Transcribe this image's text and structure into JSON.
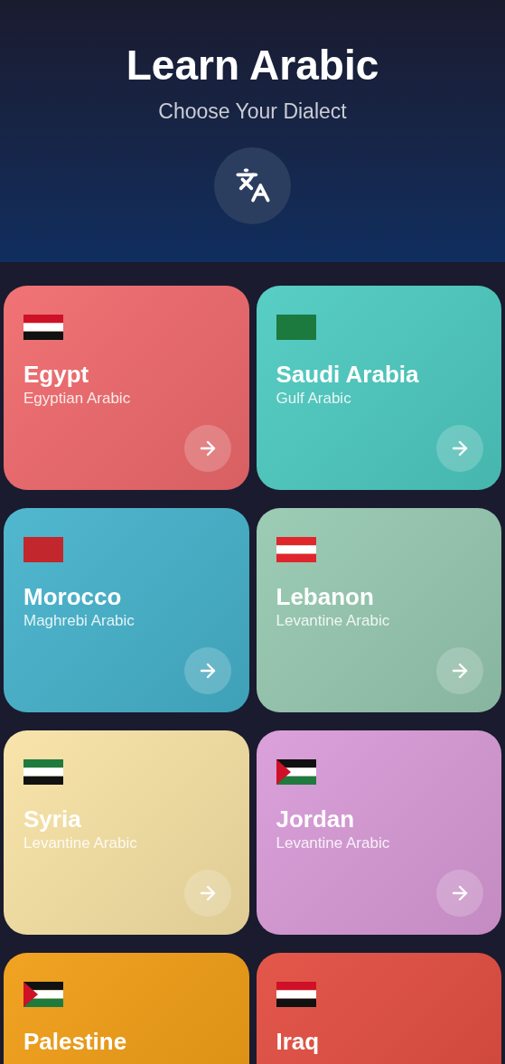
{
  "header": {
    "title": "Learn Arabic",
    "subtitle": "Choose Your Dialect"
  },
  "dialects": [
    {
      "country": "Egypt",
      "dialect": "Egyptian Arabic",
      "color": "#f06a6d",
      "flag": [
        {
          "kind": "stripe",
          "color": "#ce1126"
        },
        {
          "kind": "stripe",
          "color": "#ffffff"
        },
        {
          "kind": "stripe",
          "color": "#111111"
        }
      ]
    },
    {
      "country": "Saudi Arabia",
      "dialect": "Gulf Arabic",
      "color": "#4ecbc1",
      "flag": [
        {
          "kind": "stripe",
          "color": "#1c7a3e"
        }
      ]
    },
    {
      "country": "Morocco",
      "dialect": "Maghrebi Arabic",
      "color": "#46b3cc",
      "flag": [
        {
          "kind": "stripe",
          "color": "#c1272d"
        }
      ]
    },
    {
      "country": "Lebanon",
      "dialect": "Levantine Arabic",
      "color": "#97c9b1",
      "flag": [
        {
          "kind": "stripe",
          "color": "#e0262b"
        },
        {
          "kind": "stripe",
          "color": "#ffffff"
        },
        {
          "kind": "stripe",
          "color": "#e0262c"
        }
      ]
    },
    {
      "country": "Syria",
      "dialect": "Levantine Arabic",
      "color": "#f8e3a5",
      "flag": [
        {
          "kind": "stripe",
          "color": "#1f7a3e"
        },
        {
          "kind": "stripe",
          "color": "#ffffff"
        },
        {
          "kind": "stripe",
          "color": "#111111"
        }
      ]
    },
    {
      "country": "Jordan",
      "dialect": "Levantine Arabic",
      "color": "#d99bd8",
      "flag": [
        {
          "kind": "stripe",
          "color": "#111111"
        },
        {
          "kind": "stripe",
          "color": "#ffffff"
        },
        {
          "kind": "stripe",
          "color": "#1f7a3e"
        },
        {
          "kind": "triangle",
          "color": "#ce1126"
        }
      ]
    },
    {
      "country": "Palestine",
      "color": "#f09d15",
      "flag": [
        {
          "kind": "stripe",
          "color": "#111111"
        },
        {
          "kind": "stripe",
          "color": "#ffffff"
        },
        {
          "kind": "stripe",
          "color": "#1f7a3e"
        },
        {
          "kind": "triangle",
          "color": "#ce1126"
        }
      ]
    },
    {
      "country": "Iraq",
      "color": "#e24d40",
      "flag": [
        {
          "kind": "stripe",
          "color": "#ce1126"
        },
        {
          "kind": "stripe",
          "color": "#ffffff"
        },
        {
          "kind": "stripe",
          "color": "#111111"
        }
      ]
    }
  ]
}
